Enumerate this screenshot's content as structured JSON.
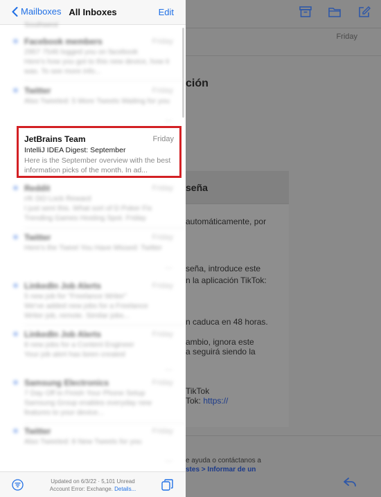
{
  "nav": {
    "back_label": "Mailboxes",
    "title": "All Inboxes",
    "edit_label": "Edit"
  },
  "list": {
    "top_fragment": "Southwest",
    "items": [
      {
        "sender": "Facebook members",
        "date": "Friday",
        "line1": "2957 7546 logged you on facebook",
        "line2": "Here's how you got to this new device, how it",
        "line3": "was. To see more info..."
      },
      {
        "sender": "Twitter",
        "date": "Friday",
        "line1": "Also Tweeted: 5 More Tweets Waiting for you"
      },
      {
        "sender": "Reddit",
        "date": "Friday",
        "line1": "r/K DO Lock Reward",
        "line2": "I just sent this. What sort of D Poker Fix",
        "line3": "Trending Games Hosting Spot. Friday"
      },
      {
        "sender": "Twitter",
        "date": "Friday",
        "line1": "Here's the Tweet You Have Missed: Twitter"
      },
      {
        "sender": "LinkedIn Job Alerts",
        "date": "Friday",
        "line1": "5 new job for \"Freelance Writer\"",
        "line2": "We've added new jobs for a Freelance",
        "line3": "Writer job, remote. Similar jobs..."
      },
      {
        "sender": "LinkedIn Job Alerts",
        "date": "Friday",
        "line1": "8 new jobs for a Content Engineer",
        "line2": "Your job alert has been created"
      },
      {
        "sender": "Samsung Electronics",
        "date": "Friday",
        "line1": "7 Day Off to Finish Your Phone Setup",
        "line2": "Samsung Group enables everyday new",
        "line3": "features to your device..."
      },
      {
        "sender": "Twitter",
        "date": "Friday",
        "line1": "Also Tweeted: 8 New Tweets for you"
      }
    ],
    "highlighted": {
      "sender": "JetBrains Team",
      "date": "Friday",
      "subject": "IntelliJ IDEA Digest: September",
      "preview": "Here is the September overview with the best information picks of the month. In ad..."
    }
  },
  "bottombar": {
    "status_line1": "Updated on 6/3/22 · 5,101 Unread",
    "status_line2": "Account Error: Exchange.",
    "details_link": "Details..."
  },
  "detail": {
    "date": "Friday",
    "subject_fragment": "ción",
    "card_title": "seña",
    "lines": [
      "automáticamente, por",
      "seña, introduce este",
      "n la aplicación TikTok:",
      "n caduca en 48 horas.",
      "ambio, ignora este",
      "a seguirá siendo la"
    ],
    "signature": "TikTok",
    "link_prefix": "Tok:",
    "link_text": "https://",
    "footer_line1": "e ayuda o contáctanos a",
    "footer_link": "stes > Informar de un"
  },
  "colors": {
    "accent": "#1f6fe5",
    "highlight_border": "#d32024",
    "unread_dot": "#9fbbef"
  },
  "icons": [
    "chevron-left-icon",
    "archive-icon",
    "folder-icon",
    "compose-icon",
    "filter-icon",
    "stacked-windows-icon",
    "reply-icon"
  ]
}
